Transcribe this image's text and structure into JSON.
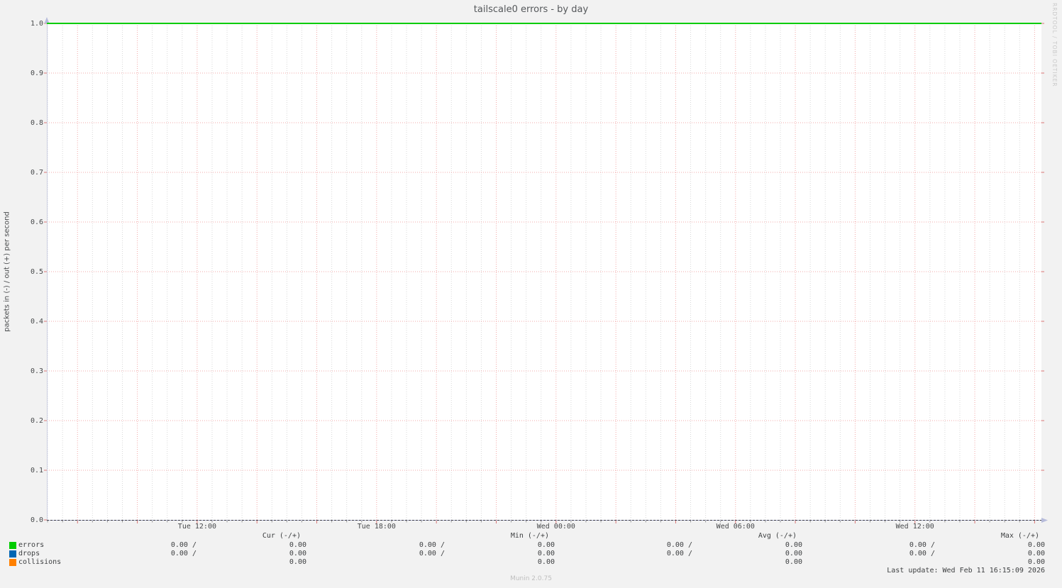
{
  "title": "tailscale0 errors - by day",
  "watermark": "RRDTOOL / TOBI OETIKER",
  "footer": {
    "munin_version": "Munin 2.0.75",
    "last_update": "Last update: Wed Feb 11 16:15:09 2026"
  },
  "chart_data": {
    "type": "line",
    "title": "tailscale0 errors - by day",
    "xlabel": "",
    "ylabel": "packets in (-) / out (+) per second",
    "ylim": [
      0.0,
      1.0
    ],
    "y_ticks": [
      "0.0",
      "0.1",
      "0.2",
      "0.3",
      "0.4",
      "0.5",
      "0.6",
      "0.7",
      "0.8",
      "0.9",
      "1.0"
    ],
    "x_tick_labels": [
      "Tue 12:00",
      "Tue 18:00",
      "Wed 00:00",
      "Wed 06:00",
      "Wed 12:00"
    ],
    "x_minor_interval": "30min",
    "x_major_interval": "2h",
    "x_label_interval": "6h",
    "grid": true,
    "legend_position": "bottom",
    "series": [
      {
        "name": "errors",
        "color": "#00cc00",
        "visible_constant_y": 1.0
      },
      {
        "name": "drops",
        "color": "#0066b3",
        "visible_constant_y": null
      },
      {
        "name": "collisions",
        "color": "#ff8000",
        "visible_constant_y": null
      }
    ]
  },
  "legend": {
    "headers": [
      "Cur (-/+)",
      "Min (-/+)",
      "Avg (-/+)",
      "Max (-/+)"
    ],
    "rows": [
      {
        "label": "errors",
        "color": "#00cc00",
        "values": [
          [
            "0.00 /",
            "0.00"
          ],
          [
            "0.00 /",
            "0.00"
          ],
          [
            "0.00 /",
            "0.00"
          ],
          [
            "0.00 /",
            "0.00"
          ]
        ]
      },
      {
        "label": "drops",
        "color": "#0066b3",
        "values": [
          [
            "0.00 /",
            "0.00"
          ],
          [
            "0.00 /",
            "0.00"
          ],
          [
            "0.00 /",
            "0.00"
          ],
          [
            "0.00 /",
            "0.00"
          ]
        ]
      },
      {
        "label": "collisions",
        "color": "#ff8000",
        "values": [
          [
            "",
            "0.00"
          ],
          [
            "",
            "0.00"
          ],
          [
            "",
            "0.00"
          ],
          [
            "",
            "0.00"
          ]
        ]
      }
    ]
  }
}
